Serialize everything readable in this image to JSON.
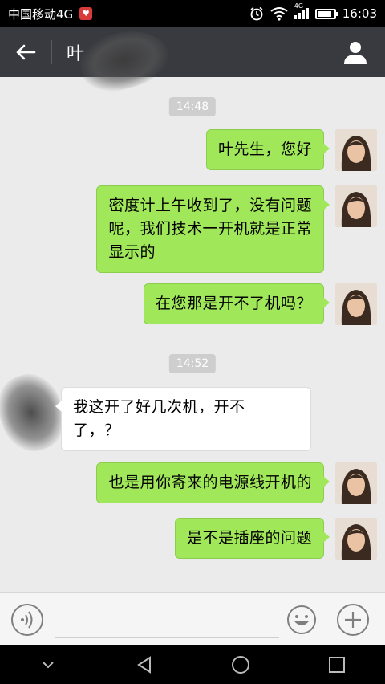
{
  "status_bar": {
    "carrier": "中国移动4G",
    "time": "16:03",
    "network": "4G",
    "battery_level": 0.85
  },
  "header": {
    "contact_name": "叶"
  },
  "messages": [
    {
      "type": "time",
      "text": "14:48"
    },
    {
      "type": "outgoing",
      "text": "叶先生，您好"
    },
    {
      "type": "outgoing",
      "lines": [
        "密度计上午收到了，没有问题",
        "呢，我们技术一开机就是正常",
        "显示的"
      ]
    },
    {
      "type": "outgoing",
      "text": "在您那是开不了机吗？"
    },
    {
      "type": "time",
      "text": "14:52"
    },
    {
      "type": "incoming",
      "lines": [
        "我这开了好几次机，开不",
        "了，？"
      ]
    },
    {
      "type": "outgoing",
      "text": "也是用你寄来的电源线开机的"
    },
    {
      "type": "outgoing",
      "text": "是不是插座的问题"
    }
  ],
  "input_bar": {
    "value": ""
  },
  "colors": {
    "outgoing_bubble": "#a0e75a",
    "incoming_bubble": "#ffffff",
    "header_bg": "#393a3f",
    "chat_bg": "#ebebeb"
  }
}
